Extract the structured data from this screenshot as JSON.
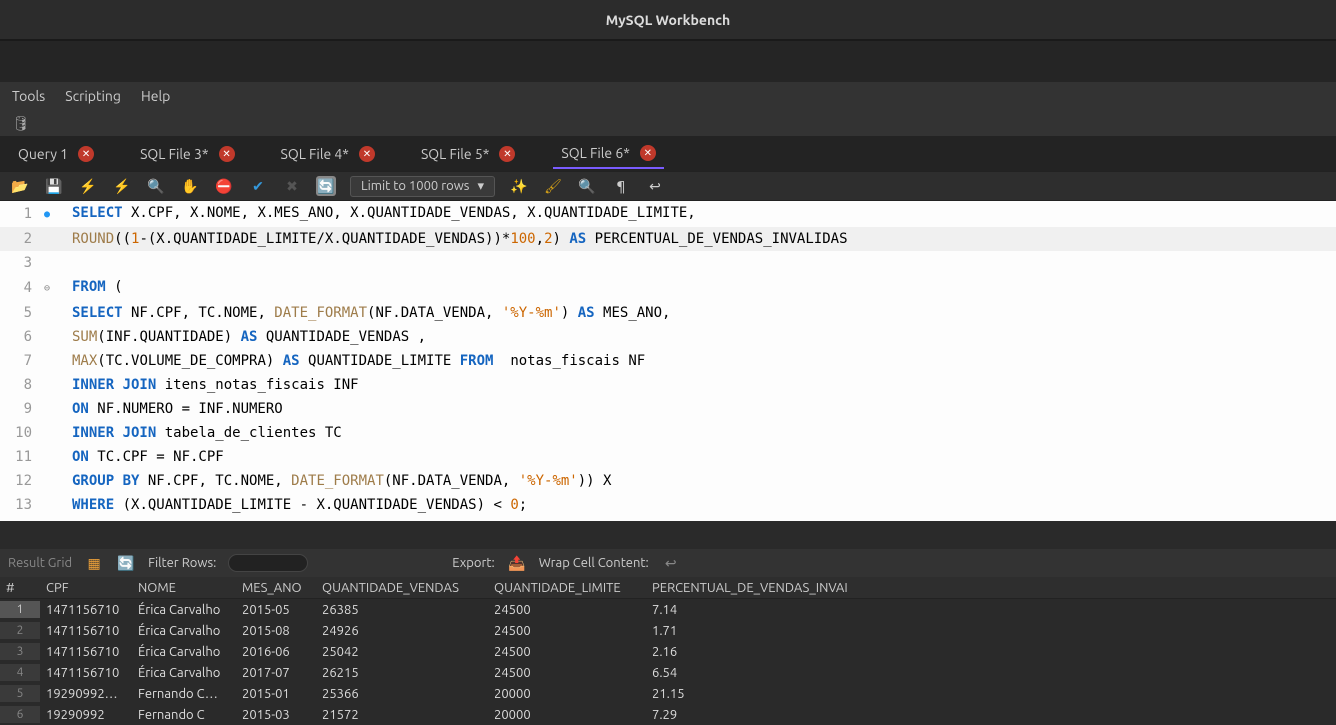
{
  "window": {
    "title": "MySQL Workbench"
  },
  "menu": {
    "items": [
      "Tools",
      "Scripting",
      "Help"
    ]
  },
  "tabs": [
    {
      "label": "Query 1",
      "active": false
    },
    {
      "label": "SQL File 3*",
      "active": false
    },
    {
      "label": "SQL File 4*",
      "active": false
    },
    {
      "label": "SQL File 5*",
      "active": false
    },
    {
      "label": "SQL File 6*",
      "active": true
    }
  ],
  "toolbar": {
    "limit_label": "Limit to 1000 rows"
  },
  "editor": {
    "lines": [
      {
        "n": 1,
        "mark": "dot",
        "tokens": [
          [
            "kw",
            "SELECT"
          ],
          [
            "",
            " X.CPF, X.NOME, X.MES_ANO, X.QUANTIDADE_VENDAS, X.QUANTIDADE_LIMITE,"
          ]
        ]
      },
      {
        "n": 2,
        "current": true,
        "tokens": [
          [
            "fn",
            "ROUND"
          ],
          [
            "",
            "(("
          ],
          [
            "num",
            "1"
          ],
          [
            "",
            "-(X.QUANTIDADE_LIMITE/X.QUANTIDADE_VENDAS))*"
          ],
          [
            "num",
            "100"
          ],
          [
            "",
            ","
          ],
          [
            "num",
            "2"
          ],
          [
            "",
            ") "
          ],
          [
            "kw",
            "AS"
          ],
          [
            "",
            " PERCENTUAL_DE_VENDAS_INVALIDAS"
          ]
        ]
      },
      {
        "n": 3,
        "tokens": [
          [
            "",
            ""
          ]
        ]
      },
      {
        "n": 4,
        "mark": "fold",
        "tokens": [
          [
            "kw",
            "FROM"
          ],
          [
            "",
            " ("
          ]
        ]
      },
      {
        "n": 5,
        "tokens": [
          [
            "kw",
            "SELECT"
          ],
          [
            "",
            " NF.CPF, TC.NOME, "
          ],
          [
            "fn",
            "DATE_FORMAT"
          ],
          [
            "",
            "(NF.DATA_VENDA, "
          ],
          [
            "str",
            "'%Y-%m'"
          ],
          [
            "",
            ") "
          ],
          [
            "kw",
            "AS"
          ],
          [
            "",
            " MES_ANO,"
          ]
        ]
      },
      {
        "n": 6,
        "tokens": [
          [
            "fn",
            "SUM"
          ],
          [
            "",
            "(INF.QUANTIDADE) "
          ],
          [
            "kw",
            "AS"
          ],
          [
            "",
            " QUANTIDADE_VENDAS ,"
          ]
        ]
      },
      {
        "n": 7,
        "tokens": [
          [
            "fn",
            "MAX"
          ],
          [
            "",
            "(TC.VOLUME_DE_COMPRA) "
          ],
          [
            "kw",
            "AS"
          ],
          [
            "",
            " QUANTIDADE_LIMITE "
          ],
          [
            "kw",
            "FROM"
          ],
          [
            "",
            "  notas_fiscais NF"
          ]
        ]
      },
      {
        "n": 8,
        "tokens": [
          [
            "kw",
            "INNER JOIN"
          ],
          [
            "",
            " itens_notas_fiscais INF"
          ]
        ]
      },
      {
        "n": 9,
        "tokens": [
          [
            "kw",
            "ON"
          ],
          [
            "",
            " NF.NUMERO = INF.NUMERO"
          ]
        ]
      },
      {
        "n": 10,
        "tokens": [
          [
            "kw",
            "INNER JOIN"
          ],
          [
            "",
            " tabela_de_clientes TC"
          ]
        ]
      },
      {
        "n": 11,
        "tokens": [
          [
            "kw",
            "ON"
          ],
          [
            "",
            " TC.CPF = NF.CPF"
          ]
        ]
      },
      {
        "n": 12,
        "tokens": [
          [
            "kw",
            "GROUP BY"
          ],
          [
            "",
            " NF.CPF, TC.NOME, "
          ],
          [
            "fn",
            "DATE_FORMAT"
          ],
          [
            "",
            "(NF.DATA_VENDA, "
          ],
          [
            "str",
            "'%Y-%m'"
          ],
          [
            "",
            ")) X"
          ]
        ]
      },
      {
        "n": 13,
        "tokens": [
          [
            "kw",
            "WHERE"
          ],
          [
            "",
            " (X.QUANTIDADE_LIMITE - X.QUANTIDADE_VENDAS) < "
          ],
          [
            "num",
            "0"
          ],
          [
            "",
            ";"
          ]
        ]
      }
    ]
  },
  "grid_toolbar": {
    "result_label": "Result Grid",
    "filter_label": "Filter Rows:",
    "filter_value": "",
    "export_label": "Export:",
    "wrap_label": "Wrap Cell Content:"
  },
  "grid": {
    "headers": [
      "#",
      "CPF",
      "NOME",
      "MES_ANO",
      "QUANTIDADE_VENDAS",
      "QUANTIDADE_LIMITE",
      "PERCENTUAL_DE_VENDAS_INVAI"
    ],
    "rows": [
      {
        "i": 1,
        "cpf": "1471156710",
        "nome": "Érica Carvalho",
        "mes": "2015-05",
        "qv": "26385",
        "ql": "24500",
        "pct": "7.14"
      },
      {
        "i": 2,
        "cpf": "1471156710",
        "nome": "Érica Carvalho",
        "mes": "2015-08",
        "qv": "24926",
        "ql": "24500",
        "pct": "1.71"
      },
      {
        "i": 3,
        "cpf": "1471156710",
        "nome": "Érica Carvalho",
        "mes": "2016-06",
        "qv": "25042",
        "ql": "24500",
        "pct": "2.16"
      },
      {
        "i": 4,
        "cpf": "1471156710",
        "nome": "Érica Carvalho",
        "mes": "2017-07",
        "qv": "26215",
        "ql": "24500",
        "pct": "6.54"
      },
      {
        "i": 5,
        "cpf": "19290992…",
        "nome": "Fernando C…",
        "mes": "2015-01",
        "qv": "25366",
        "ql": "20000",
        "pct": "21.15"
      },
      {
        "i": 6,
        "cpf": "19290992",
        "nome": "Fernando C",
        "mes": "2015-03",
        "qv": "21572",
        "ql": "20000",
        "pct": "7.29"
      }
    ]
  }
}
